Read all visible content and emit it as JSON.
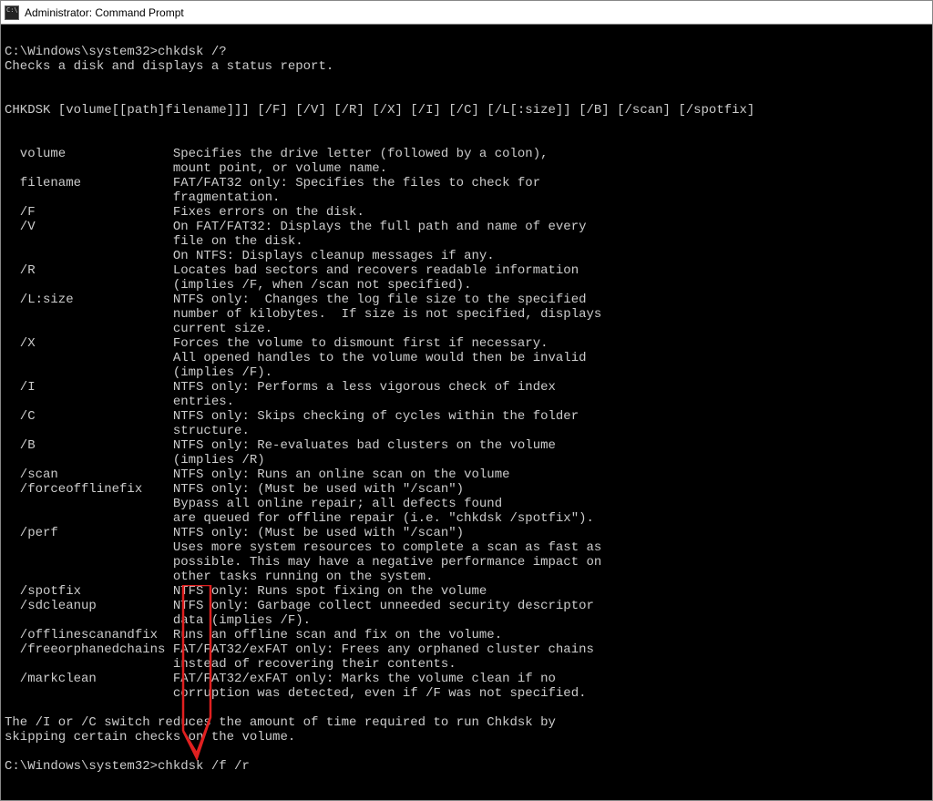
{
  "titlebar": {
    "title": "Administrator: Command Prompt"
  },
  "terminal": {
    "line1_prompt": "C:\\Windows\\system32>",
    "line1_cmd": "chkdsk /?",
    "line2": "Checks a disk and displays a status report.",
    "blank1": "",
    "blank2": "",
    "usage": "CHKDSK [volume[[path]filename]]] [/F] [/V] [/R] [/X] [/I] [/C] [/L[:size]] [/B] [/scan] [/spotfix]",
    "blank3": "",
    "blank4": "",
    "opt_volume_1": "  volume              Specifies the drive letter (followed by a colon),",
    "opt_volume_2": "                      mount point, or volume name.",
    "opt_filename_1": "  filename            FAT/FAT32 only: Specifies the files to check for",
    "opt_filename_2": "                      fragmentation.",
    "opt_f": "  /F                  Fixes errors on the disk.",
    "opt_v_1": "  /V                  On FAT/FAT32: Displays the full path and name of every",
    "opt_v_2": "                      file on the disk.",
    "opt_v_3": "                      On NTFS: Displays cleanup messages if any.",
    "opt_r_1": "  /R                  Locates bad sectors and recovers readable information",
    "opt_r_2": "                      (implies /F, when /scan not specified).",
    "opt_lsize_1": "  /L:size             NTFS only:  Changes the log file size to the specified",
    "opt_lsize_2": "                      number of kilobytes.  If size is not specified, displays",
    "opt_lsize_3": "                      current size.",
    "opt_x_1": "  /X                  Forces the volume to dismount first if necessary.",
    "opt_x_2": "                      All opened handles to the volume would then be invalid",
    "opt_x_3": "                      (implies /F).",
    "opt_i_1": "  /I                  NTFS only: Performs a less vigorous check of index",
    "opt_i_2": "                      entries.",
    "opt_c_1": "  /C                  NTFS only: Skips checking of cycles within the folder",
    "opt_c_2": "                      structure.",
    "opt_b_1": "  /B                  NTFS only: Re-evaluates bad clusters on the volume",
    "opt_b_2": "                      (implies /R)",
    "opt_scan": "  /scan               NTFS only: Runs an online scan on the volume",
    "opt_force_1": "  /forceofflinefix    NTFS only: (Must be used with \"/scan\")",
    "opt_force_2": "                      Bypass all online repair; all defects found",
    "opt_force_3": "                      are queued for offline repair (i.e. \"chkdsk /spotfix\").",
    "opt_perf_1": "  /perf               NTFS only: (Must be used with \"/scan\")",
    "opt_perf_2": "                      Uses more system resources to complete a scan as fast as",
    "opt_perf_3": "                      possible. This may have a negative performance impact on",
    "opt_perf_4": "                      other tasks running on the system.",
    "opt_spotfix": "  /spotfix            NTFS only: Runs spot fixing on the volume",
    "opt_sdcleanup_1": "  /sdcleanup          NTFS only: Garbage collect unneeded security descriptor",
    "opt_sdcleanup_2": "                      data (implies /F).",
    "opt_offline": "  /offlinescanandfix  Runs an offline scan and fix on the volume.",
    "opt_free_1": "  /freeorphanedchains FAT/FAT32/exFAT only: Frees any orphaned cluster chains",
    "opt_free_2": "                      instead of recovering their contents.",
    "opt_mark_1": "  /markclean          FAT/FAT32/exFAT only: Marks the volume clean if no",
    "opt_mark_2": "                      corruption was detected, even if /F was not specified.",
    "blank5": "",
    "note_1": "The /I or /C switch reduces the amount of time required to run Chkdsk by",
    "note_2": "skipping certain checks on the volume.",
    "blank6": "",
    "line_final_prompt": "C:\\Windows\\system32>",
    "line_final_cmd": "chkdsk /f /r"
  }
}
